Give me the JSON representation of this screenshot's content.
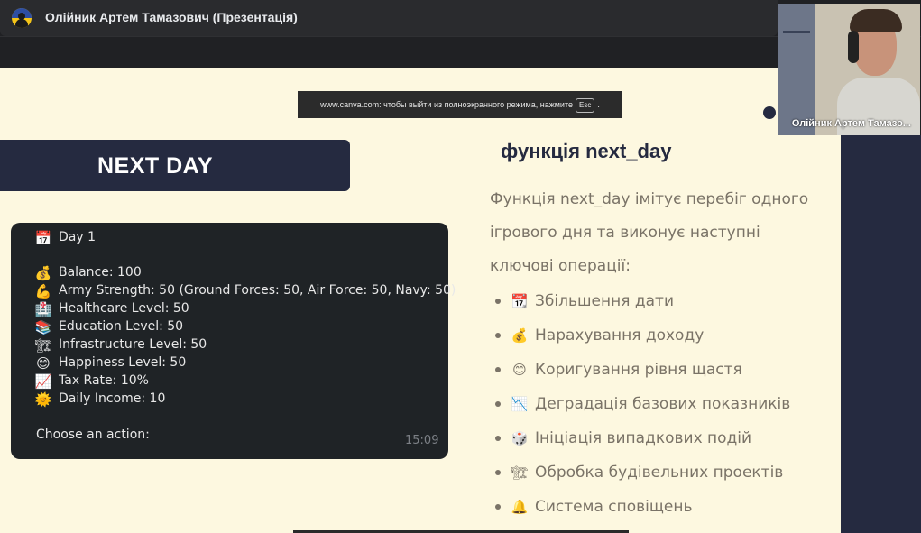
{
  "meeting": {
    "presenter_title": "Олійник Артем Тамазович (Презентація)"
  },
  "canva_tip": {
    "text_before": "www.canva.com: чтобы выйти из полноэкранного режима, нажмите",
    "key": "Esc",
    "text_after": "."
  },
  "slide": {
    "banner_title": "NEXT DAY",
    "chat": {
      "lines": [
        {
          "emoji": "📅",
          "icon": "calendar-icon",
          "text": "Day 1"
        },
        {
          "emoji": "💰",
          "icon": "money-bag-icon",
          "text": "Balance: 100"
        },
        {
          "emoji": "💪",
          "icon": "flexed-biceps-icon",
          "text": "Army Strength: 50 (Ground Forces: 50, Air Force: 50, Navy: 50)"
        },
        {
          "emoji": "🏥",
          "icon": "hospital-icon",
          "text": "Healthcare Level: 50"
        },
        {
          "emoji": "📚",
          "icon": "books-icon",
          "text": "Education Level: 50"
        },
        {
          "emoji": "🏗",
          "icon": "construction-icon",
          "text": "Infrastructure Level: 50"
        },
        {
          "emoji": "😊",
          "icon": "smiling-face-icon",
          "text": "Happiness Level: 50"
        },
        {
          "emoji": "📈",
          "icon": "chart-increasing-icon",
          "text": "Tax Rate: 10%"
        },
        {
          "emoji": "🌞",
          "icon": "sun-icon",
          "text": "Daily Income: 10"
        },
        {
          "emoji": "",
          "icon": "",
          "text": "Choose an action:"
        }
      ],
      "time": "15:09"
    },
    "func_title": "функція next_day",
    "func_desc": "Функція next_day імітує перебіг одного ігрового дня та виконує наступні ключові операції:",
    "bullets": [
      {
        "emoji": "📆",
        "icon": "calendar-icon",
        "text": "Збільшення дати"
      },
      {
        "emoji": "💰",
        "icon": "money-bag-icon",
        "text": "Нарахування доходу"
      },
      {
        "emoji": "😊",
        "icon": "smiling-face-icon",
        "text": "Коригування рівня щастя"
      },
      {
        "emoji": "📉",
        "icon": "chart-decreasing-icon",
        "text": "Деградація базових показників"
      },
      {
        "emoji": "🎲",
        "icon": "dice-icon",
        "text": "Ініціація випадкових подій"
      },
      {
        "emoji": "🏗",
        "icon": "construction-icon",
        "text": "Обробка будівельних проектів"
      },
      {
        "emoji": "🔔",
        "icon": "bell-icon",
        "text": "Система сповіщень"
      }
    ]
  },
  "camera": {
    "participant_name": "Олійник Артем Тамазо..."
  },
  "colors": {
    "slide_background": "#fdf8e0",
    "navy_accent": "#252a40",
    "chat_background": "#1f2326",
    "body_text": "#7a7367"
  }
}
